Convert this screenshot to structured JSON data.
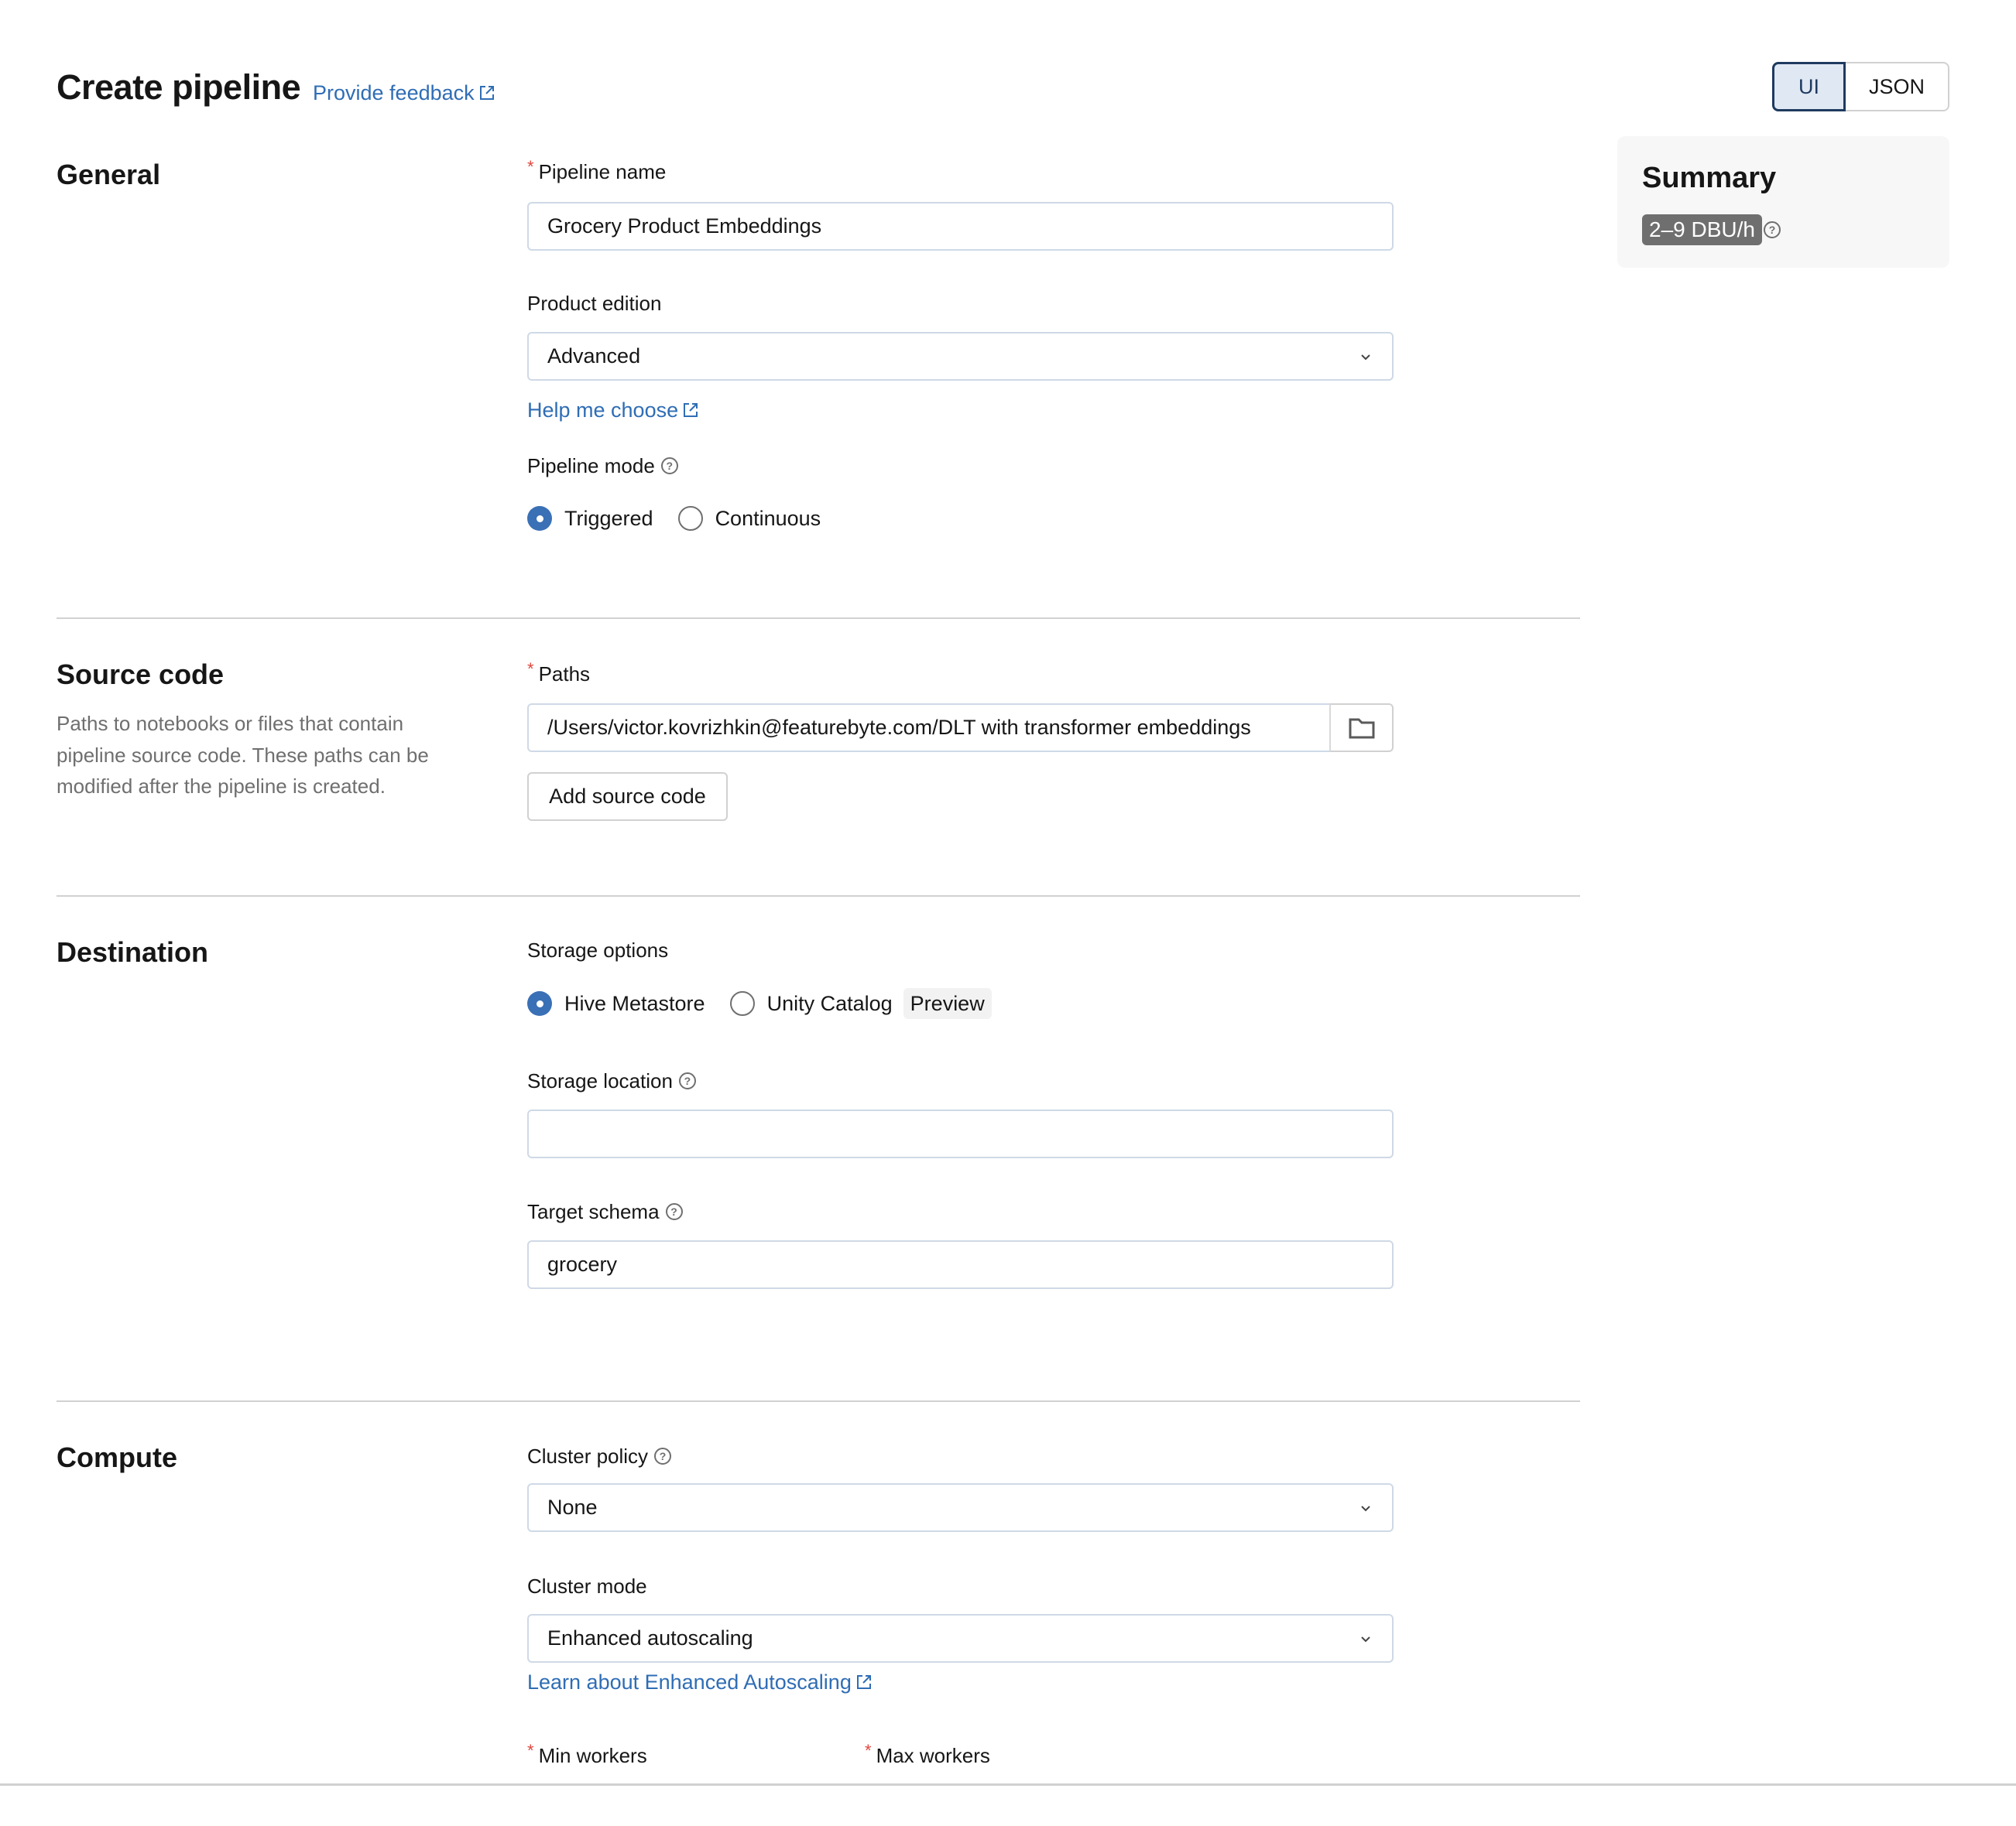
{
  "header": {
    "title": "Create pipeline",
    "feedback_link": "Provide feedback",
    "view_toggle": {
      "options": [
        "UI",
        "JSON"
      ],
      "selected": "UI"
    }
  },
  "summary": {
    "title": "Summary",
    "dbu_estimate": "2–9 DBU/h"
  },
  "sections": {
    "general": {
      "heading": "General",
      "pipeline_name": {
        "label": "Pipeline name",
        "required": true,
        "value": "Grocery Product Embeddings"
      },
      "product_edition": {
        "label": "Product edition",
        "value": "Advanced",
        "help_link": "Help me choose"
      },
      "pipeline_mode": {
        "label": "Pipeline mode",
        "options": [
          "Triggered",
          "Continuous"
        ],
        "selected": "Triggered"
      }
    },
    "source_code": {
      "heading": "Source code",
      "description": "Paths to notebooks or files that contain pipeline source code. These paths can be modified after the pipeline is created.",
      "paths": {
        "label": "Paths",
        "required": true,
        "value": "/Users/victor.kovrizhkin@featurebyte.com/DLT with transformer embeddings"
      },
      "add_button": "Add source code"
    },
    "destination": {
      "heading": "Destination",
      "storage_options": {
        "label": "Storage options",
        "options": [
          "Hive Metastore",
          "Unity Catalog"
        ],
        "selected": "Hive Metastore",
        "badge": "Preview"
      },
      "storage_location": {
        "label": "Storage location",
        "value": ""
      },
      "target_schema": {
        "label": "Target schema",
        "value": "grocery"
      }
    },
    "compute": {
      "heading": "Compute",
      "cluster_policy": {
        "label": "Cluster policy",
        "value": "None"
      },
      "cluster_mode": {
        "label": "Cluster mode",
        "value": "Enhanced autoscaling",
        "help_link": "Learn about Enhanced Autoscaling"
      },
      "min_workers": {
        "label": "Min workers",
        "required": true
      },
      "max_workers": {
        "label": "Max workers",
        "required": true
      }
    }
  }
}
